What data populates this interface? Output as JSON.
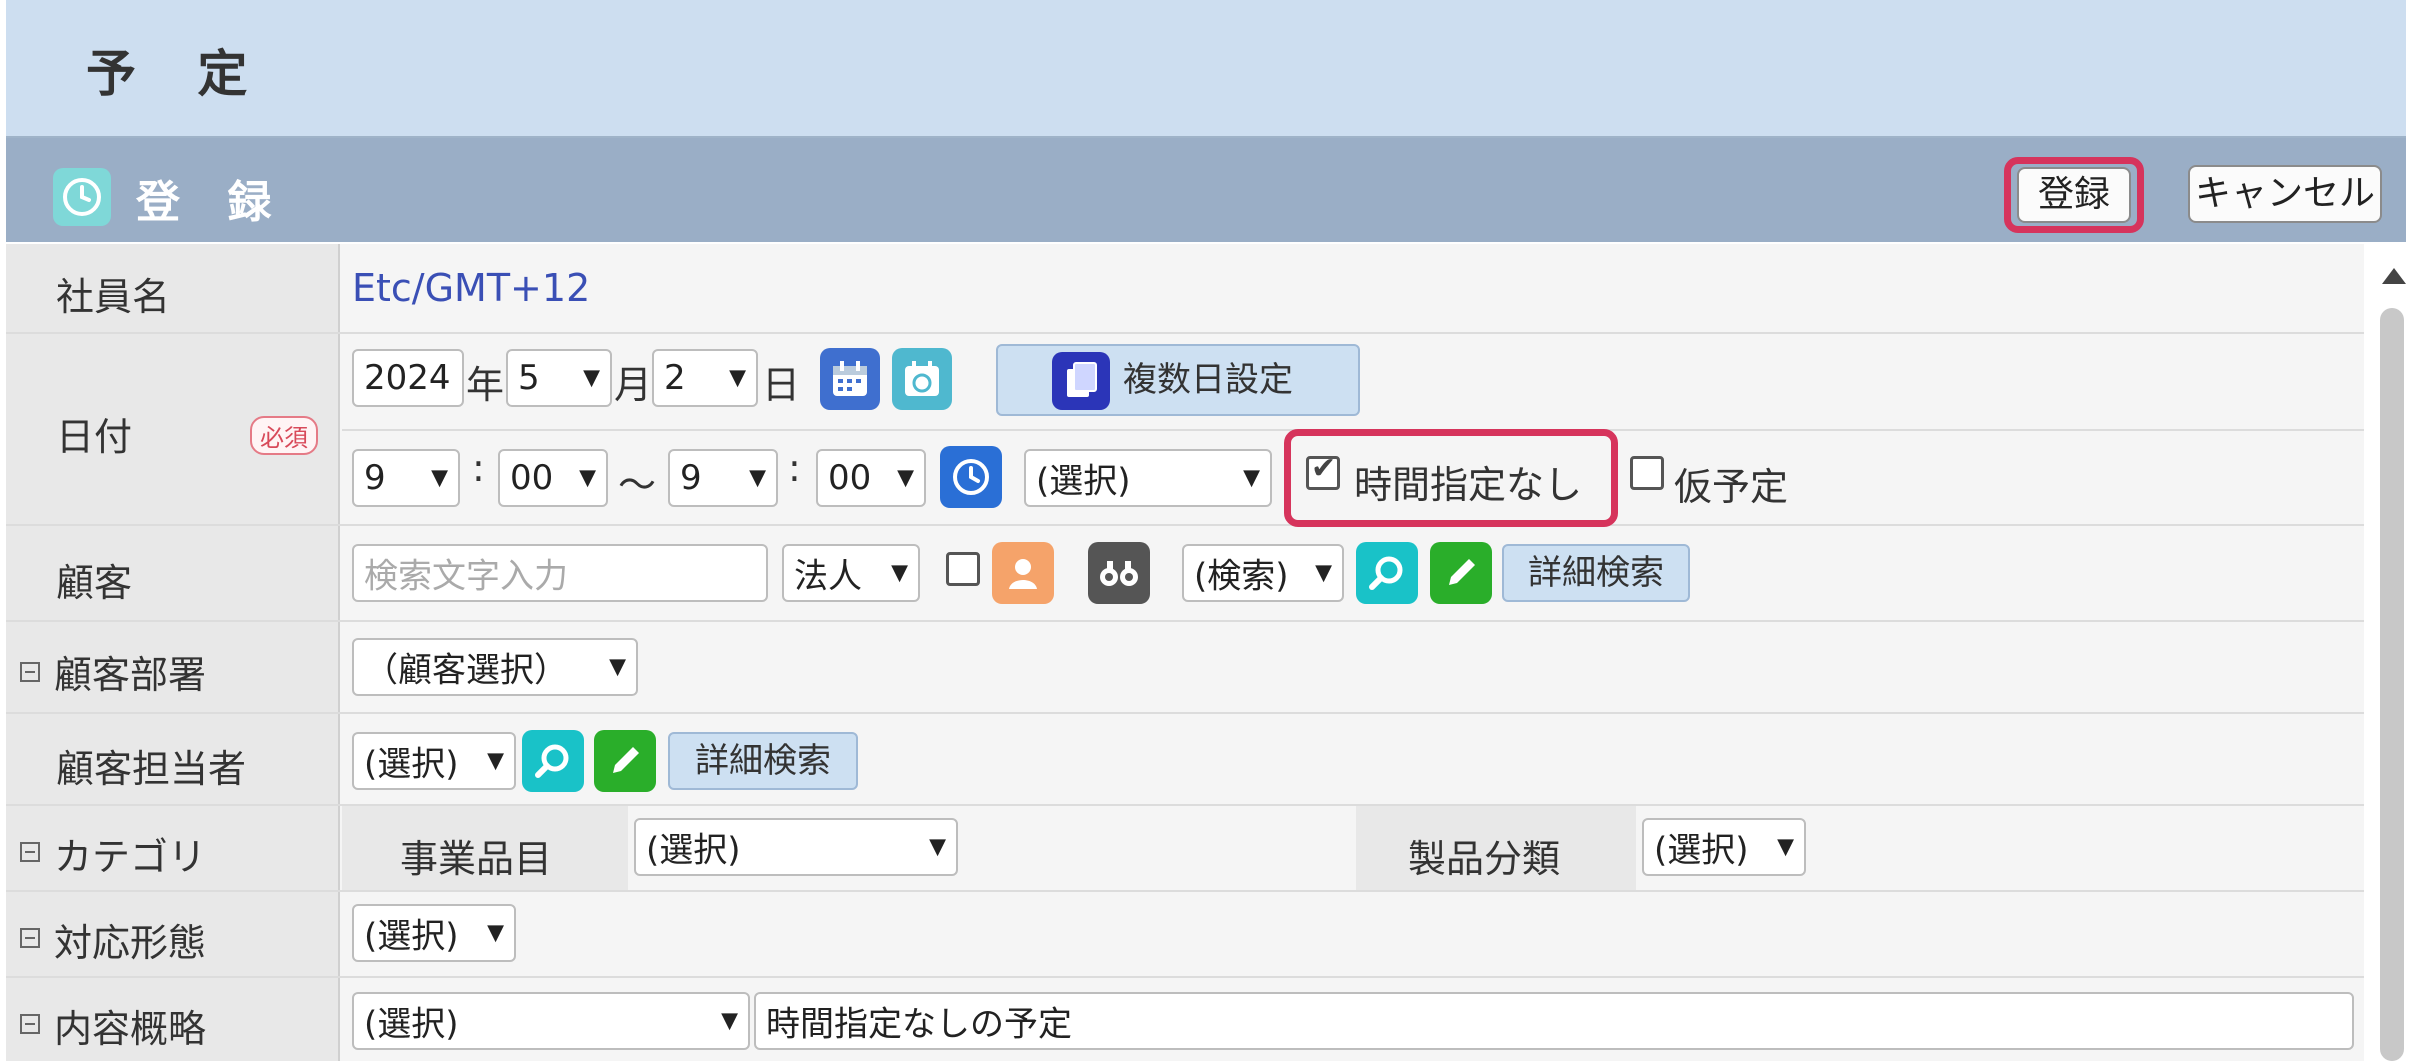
{
  "page": {
    "title": "予 定"
  },
  "register_bar": {
    "title": "登 録",
    "icon": "clock-icon",
    "register_button": "登録",
    "cancel_button": "キャンセル"
  },
  "form": {
    "employee": {
      "label": "社員名",
      "value": "Etc/GMT+12"
    },
    "date": {
      "label": "日付",
      "required_badge": "必須",
      "year": "2024",
      "year_unit": "年",
      "month": "5",
      "month_unit": "月",
      "day": "2",
      "day_unit": "日",
      "multi_day_button": "複数日設定",
      "start_hour": "9",
      "start_minute": "00",
      "tilde": "〜",
      "colon": ":",
      "end_hour": "9",
      "end_minute": "00",
      "time_select": "(選択)",
      "no_time_label": "時間指定なし",
      "no_time_checked": true,
      "tentative_label": "仮予定",
      "tentative_checked": false
    },
    "customer": {
      "label": "顧客",
      "search_placeholder": "検索文字入力",
      "type_select": "法人",
      "search_select": "(検索)",
      "detail_search": "詳細検索"
    },
    "customer_dept": {
      "label": "顧客部署",
      "select": "（顧客選択）"
    },
    "customer_contact": {
      "label": "顧客担当者",
      "select": "(選択)",
      "detail_search": "詳細検索"
    },
    "category": {
      "label": "カテゴリ",
      "business_item_label": "事業品目",
      "business_item_select": "(選択)",
      "product_class_label": "製品分類",
      "product_class_select": "(選択)"
    },
    "response_type": {
      "label": "対応形態",
      "select": "(選択)"
    },
    "summary": {
      "label": "内容概略",
      "select": "(選択)",
      "text": "時間指定なしの予定"
    }
  },
  "colors": {
    "header_bg": "#cddef0",
    "register_bar_bg": "#9aaec6",
    "highlight": "#d6345c",
    "link_text": "#3a4fb5"
  }
}
